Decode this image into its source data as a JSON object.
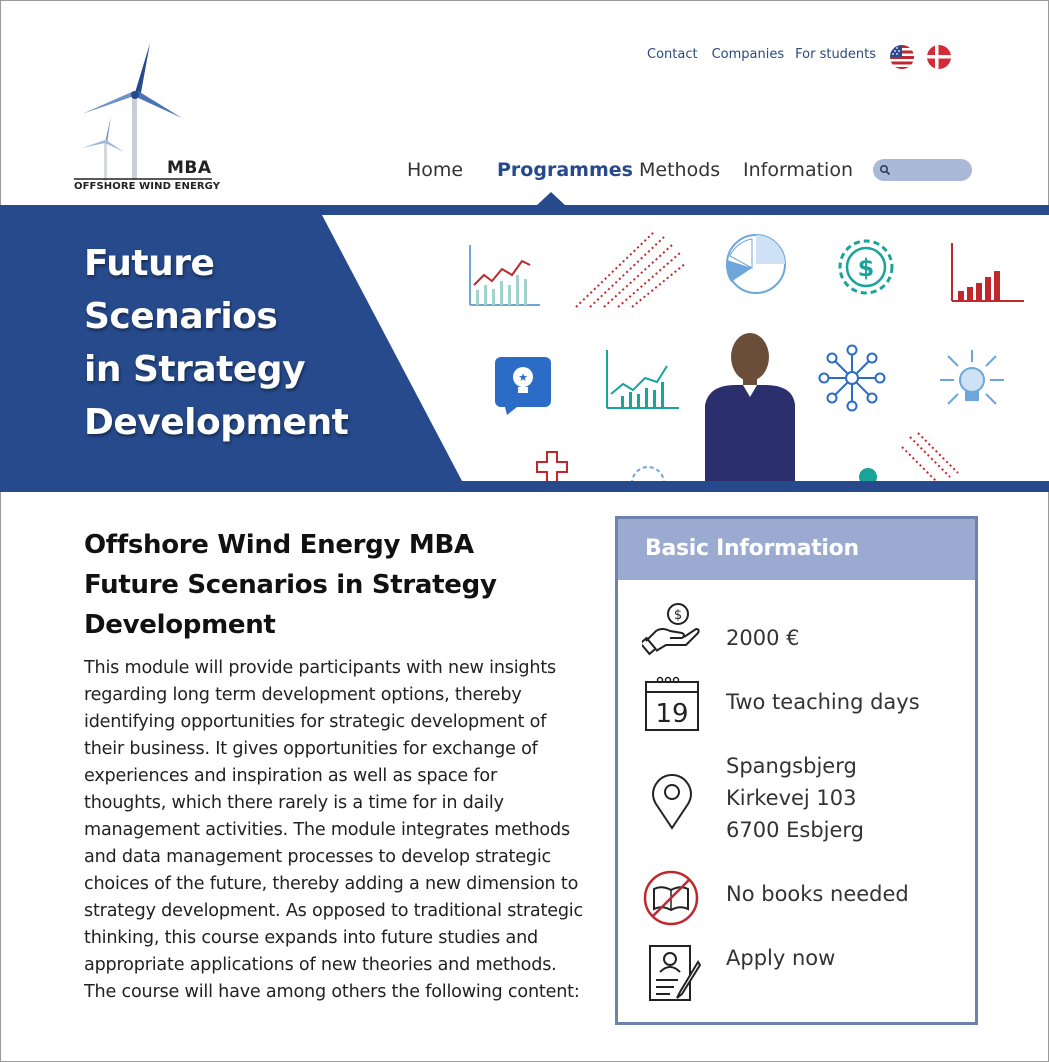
{
  "logo": {
    "mba": "MBA",
    "subtitle": "OFFSHORE WIND ENERGY"
  },
  "toplinks": [
    "Contact",
    "Companies",
    "For students"
  ],
  "flags": [
    "us-flag-icon",
    "dk-flag-icon"
  ],
  "nav": {
    "items": [
      "Home",
      "Programmes",
      "Methods",
      "Information"
    ],
    "active": "Programmes"
  },
  "search": {
    "placeholder": "",
    "icon": "search-icon"
  },
  "banner": {
    "title_lines": [
      "Future",
      "Scenarios",
      "in Strategy",
      "Development"
    ],
    "accent": "#264a8c"
  },
  "content": {
    "title_lines": [
      "Offshore Wind Energy MBA",
      "Future Scenarios in Strategy",
      "Development"
    ],
    "body": "This module will provide participants with new insights regarding long term development options, thereby identifying opportunities for strategic development of their business. It gives opportunities for exchange of experiences and inspiration as well as space for thoughts, which there rarely is a time for in daily management activities. The module integrates methods and data management processes to develop strategic choices of the future, thereby adding a new dimension to strategy development. As opposed to traditional strategic thinking, this course expands into future studies and appropriate applications of new theories and methods. The course will have among others the following content:"
  },
  "info": {
    "title": "Basic Information",
    "price": "2000 €",
    "days": "Two teaching days",
    "calendar_day": "19",
    "location_lines": [
      "Spangsbjerg",
      "Kirkevej 103",
      "6700 Esbjerg"
    ],
    "books": "No books needed",
    "apply": "Apply now"
  },
  "colors": {
    "primary": "#264a8c",
    "info_head": "#9aaad0",
    "info_border": "#6d83ae",
    "red": "#c0282e",
    "teal": "#1aa39a",
    "light_blue": "#6ea6dc"
  }
}
